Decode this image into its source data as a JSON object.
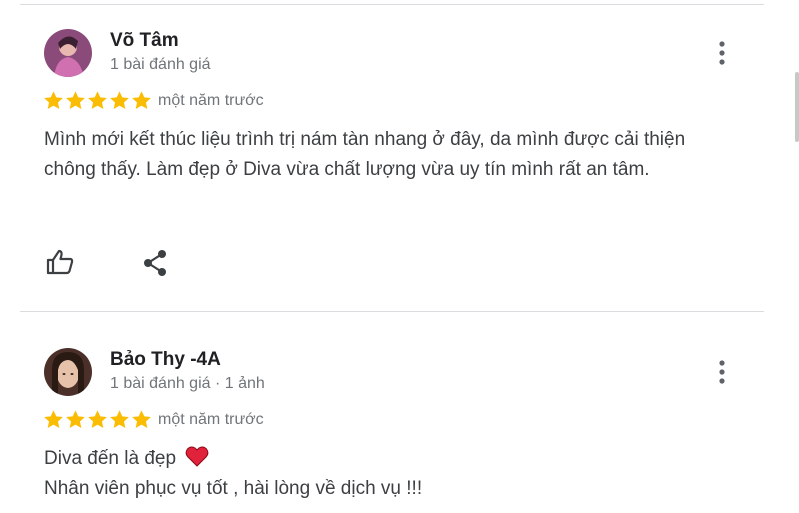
{
  "reviews": [
    {
      "author": "Võ Tâm",
      "meta": "1 bài đánh giá",
      "rating": 5,
      "time": "một năm trước",
      "text_lines": [
        "Mình mới kết thúc liệu trình trị nám tàn nhang ở đây, da mình được cải thiện chông thấy. Làm đẹp ở Diva vừa chất lượng vừa uy tín mình rất an tâm."
      ]
    },
    {
      "author": "Bảo Thy -4A",
      "meta": "1 bài đánh giá · 1 ảnh",
      "rating": 5,
      "time": "một năm trước",
      "text_lines": [
        "Diva đến là đẹp",
        "Nhân viên phục vụ tốt , hài lòng về dịch vụ !!!"
      ]
    }
  ],
  "colors": {
    "star": "#fbbc04",
    "heart": "#e0233a",
    "icon": "#5f6368"
  },
  "icons": [
    "more-vert-icon",
    "star-icon",
    "thumb-up-icon",
    "share-icon",
    "heart-icon"
  ]
}
